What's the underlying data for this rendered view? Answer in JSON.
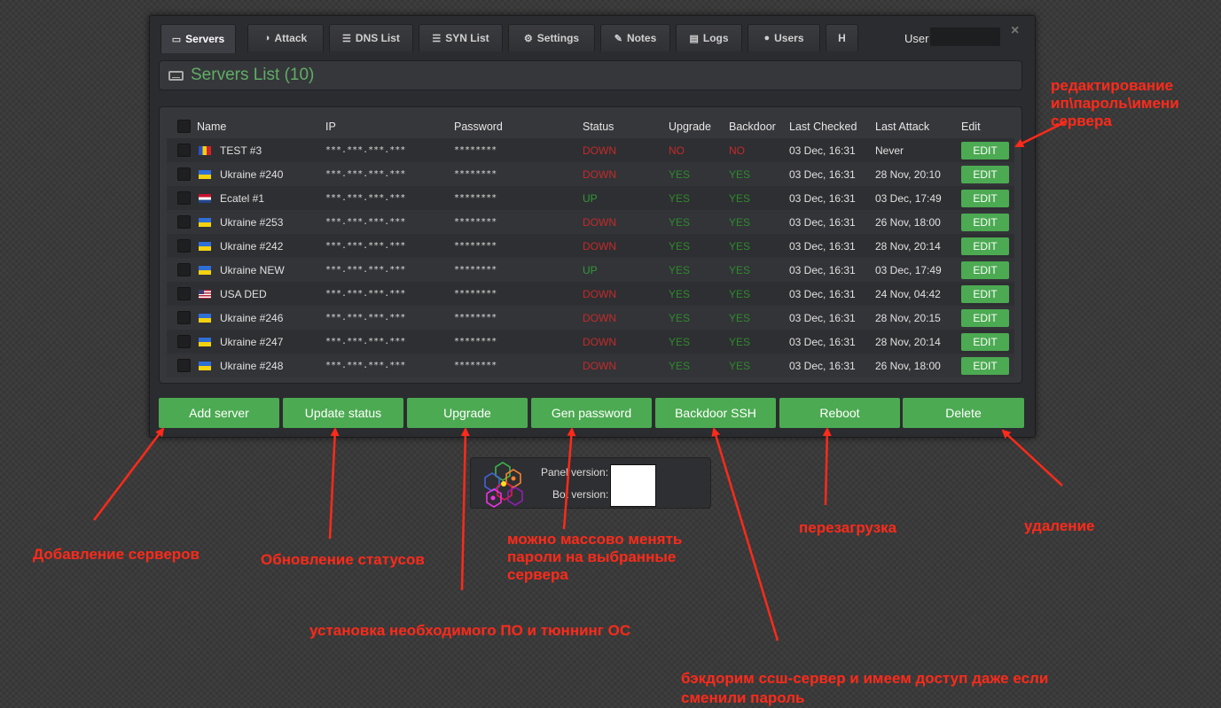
{
  "tabs": [
    {
      "label": "Servers",
      "icon": "hdd-icon",
      "glyph": "▭",
      "active": true
    },
    {
      "label": "Attack",
      "icon": "dashboard-icon",
      "glyph": "◑",
      "active": false
    },
    {
      "label": "DNS List",
      "icon": "list-icon",
      "glyph": "☰",
      "active": false
    },
    {
      "label": "SYN List",
      "icon": "list-icon",
      "glyph": "☰",
      "active": false
    },
    {
      "label": "Settings",
      "icon": "cogs-icon",
      "glyph": "⚙",
      "active": false
    },
    {
      "label": "Notes",
      "icon": "edit-icon",
      "glyph": "✎",
      "active": false
    },
    {
      "label": "Logs",
      "icon": "file-icon",
      "glyph": "▤",
      "active": false
    },
    {
      "label": "Users",
      "icon": "user-icon",
      "glyph": "●",
      "active": false
    },
    {
      "label": "H",
      "icon": "",
      "glyph": "",
      "active": false
    }
  ],
  "user": {
    "label": "User",
    "close_glyph": "×"
  },
  "page_title": "Servers List (10)",
  "columns": [
    "Name",
    "IP",
    "Password",
    "Status",
    "Upgrade",
    "Backdoor",
    "Last Checked",
    "Last Attack",
    "Edit"
  ],
  "rows": [
    {
      "flag": "ro",
      "name": "TEST #3",
      "ip": "***.***.***.***",
      "password": "********",
      "status": "DOWN",
      "upgrade": "NO",
      "backdoor": "NO",
      "checked": "03 Dec, 16:31",
      "attack": "Never",
      "edit": "EDIT"
    },
    {
      "flag": "ua",
      "name": "Ukraine #240",
      "ip": "***.***.***.***",
      "password": "********",
      "status": "DOWN",
      "upgrade": "YES",
      "backdoor": "YES",
      "checked": "03 Dec, 16:31",
      "attack": "28 Nov, 20:10",
      "edit": "EDIT"
    },
    {
      "flag": "nl",
      "name": "Ecatel #1",
      "ip": "***.***.***.***",
      "password": "********",
      "status": "UP",
      "upgrade": "YES",
      "backdoor": "YES",
      "checked": "03 Dec, 16:31",
      "attack": "03 Dec, 17:49",
      "edit": "EDIT"
    },
    {
      "flag": "ua",
      "name": "Ukraine #253",
      "ip": "***.***.***.***",
      "password": "********",
      "status": "DOWN",
      "upgrade": "YES",
      "backdoor": "YES",
      "checked": "03 Dec, 16:31",
      "attack": "26 Nov, 18:00",
      "edit": "EDIT"
    },
    {
      "flag": "ua",
      "name": "Ukraine #242",
      "ip": "***.***.***.***",
      "password": "********",
      "status": "DOWN",
      "upgrade": "YES",
      "backdoor": "YES",
      "checked": "03 Dec, 16:31",
      "attack": "28 Nov, 20:14",
      "edit": "EDIT"
    },
    {
      "flag": "ua",
      "name": "Ukraine NEW",
      "ip": "***.***.***.***",
      "password": "********",
      "status": "UP",
      "upgrade": "YES",
      "backdoor": "YES",
      "checked": "03 Dec, 16:31",
      "attack": "03 Dec, 17:49",
      "edit": "EDIT"
    },
    {
      "flag": "us",
      "name": "USA DED",
      "ip": "***.***.***.***",
      "password": "********",
      "status": "DOWN",
      "upgrade": "YES",
      "backdoor": "YES",
      "checked": "03 Dec, 16:31",
      "attack": "24 Nov, 04:42",
      "edit": "EDIT"
    },
    {
      "flag": "ua",
      "name": "Ukraine #246",
      "ip": "***.***.***.***",
      "password": "********",
      "status": "DOWN",
      "upgrade": "YES",
      "backdoor": "YES",
      "checked": "03 Dec, 16:31",
      "attack": "28 Nov, 20:15",
      "edit": "EDIT"
    },
    {
      "flag": "ua",
      "name": "Ukraine #247",
      "ip": "***.***.***.***",
      "password": "********",
      "status": "DOWN",
      "upgrade": "YES",
      "backdoor": "YES",
      "checked": "03 Dec, 16:31",
      "attack": "28 Nov, 20:14",
      "edit": "EDIT"
    },
    {
      "flag": "ua",
      "name": "Ukraine #248",
      "ip": "***.***.***.***",
      "password": "********",
      "status": "DOWN",
      "upgrade": "YES",
      "backdoor": "YES",
      "checked": "03 Dec, 16:31",
      "attack": "26 Nov, 18:00",
      "edit": "EDIT"
    }
  ],
  "actions": [
    "Add server",
    "Update status",
    "Upgrade",
    "Gen password",
    "Backdoor SSH",
    "Reboot",
    "Delete"
  ],
  "version": {
    "panel_label": "Panel version:",
    "bot_label": "Bot version:"
  },
  "annotations": {
    "edit": "редактирование\nип\\пароль\\имени\nсервера",
    "add": "Добавление серверов",
    "update": "Обновление статусов",
    "upgrade": "установка необходимого ПО и тюннинг ОС",
    "genpass": "можно массово менять\nпароли на выбранные\nсервера",
    "backdoor": "бэкдорим ссш-сервер и имеем доступ даже если\nсменили пароль",
    "reboot": "перезагрузка",
    "delete": "удаление"
  },
  "colors": {
    "accent": "#4caa52",
    "title": "#5fae66",
    "down": "#c42a2a",
    "up": "#2f9a34",
    "annotation": "#ff2a1a"
  }
}
